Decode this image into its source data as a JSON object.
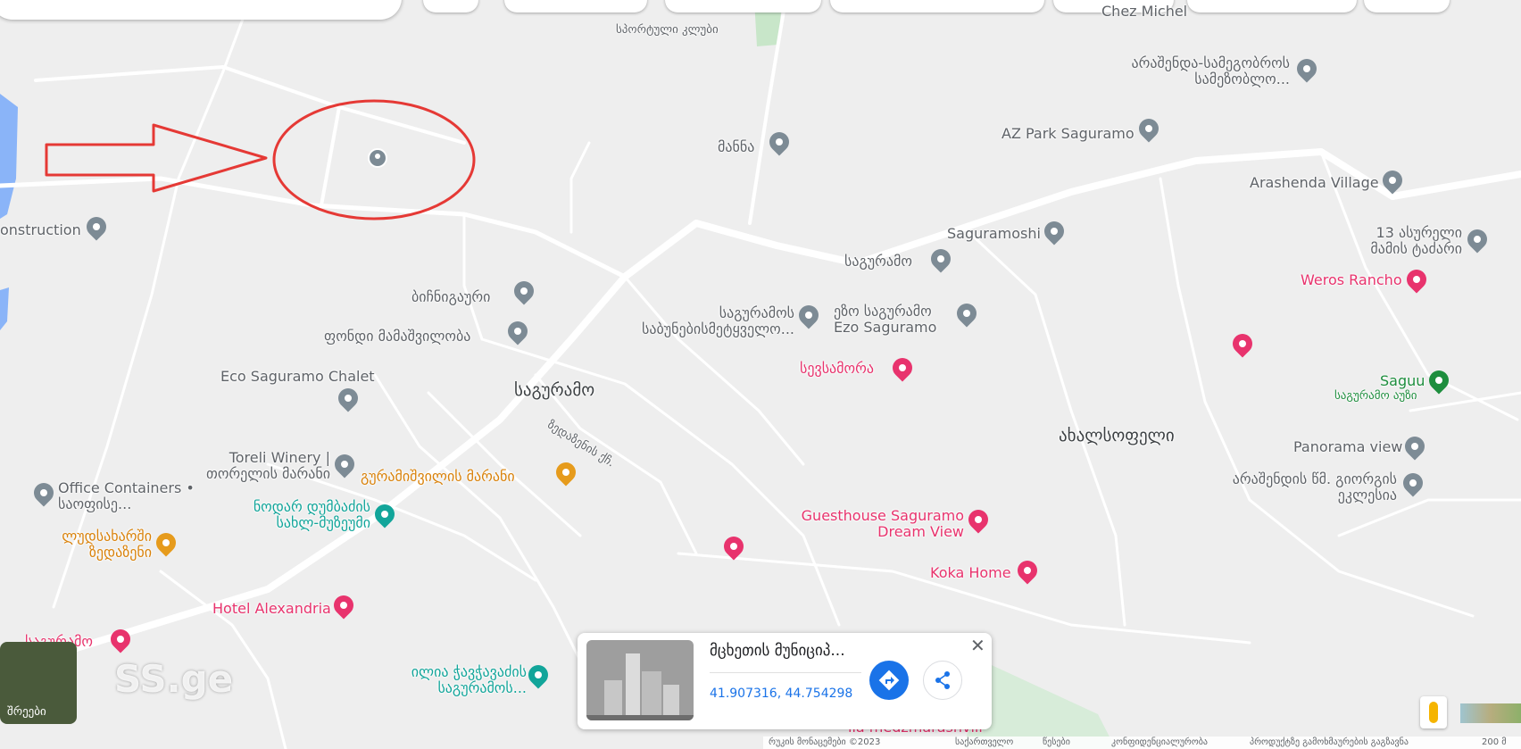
{
  "map": {
    "labels": [
      {
        "name": "construction-label",
        "text": "onstruction"
      },
      {
        "name": "mannna-label",
        "text": "მანნა"
      },
      {
        "name": "arashenda-samegobro-label",
        "text": "არაშენდა-სამეგობროს სამეზობლო..."
      },
      {
        "name": "az-park-label",
        "text": "AZ Park Saguramo"
      },
      {
        "name": "arashenda-village-label",
        "text": "Arashenda Village"
      },
      {
        "name": "saguramoshi-label",
        "text": "Saguramoshi"
      },
      {
        "name": "saguramo-poi-label",
        "text": "საგურამო"
      },
      {
        "name": "13-asureli-label",
        "text": "13 ასურელი მამის ტაძარი"
      },
      {
        "name": "weros-rancho-label",
        "text": "Weros Rancho"
      },
      {
        "name": "bichnigauri-label",
        "text": "ბიჩნიგაური"
      },
      {
        "name": "fondi-mamashvili-label",
        "text": "ფონდი მამაშვილობა"
      },
      {
        "name": "saguramos-school-label",
        "text": "საგურამოს საბუნებისმეტყველო..."
      },
      {
        "name": "ezo-saguramo-label",
        "text": "ეზო საგურამო Ezo Saguramo"
      },
      {
        "name": "sevsamora-label",
        "text": "სევსამორა"
      },
      {
        "name": "saguu-label",
        "text": "Saguu"
      },
      {
        "name": "saguu-sub-label",
        "text": "საგურამო აუზი"
      },
      {
        "name": "eco-chalet-label",
        "text": "Eco Saguramo Chalet"
      },
      {
        "name": "saguramo-village-label",
        "text": "საგურამო"
      },
      {
        "name": "street-label",
        "text": "ზედაზენის ქჩ."
      },
      {
        "name": "akhalsopeli-label",
        "text": "ახალსოფელი"
      },
      {
        "name": "panorama-view-label",
        "text": "Panorama view"
      },
      {
        "name": "toreli-winery-label",
        "text": "Toreli Winery | თორელის მარანი"
      },
      {
        "name": "guramishvili-marani-label",
        "text": "გურამიშვილის მარანი"
      },
      {
        "name": "church-label",
        "text": "არაშენდის წმ. გიორგის ეკლესია"
      },
      {
        "name": "office-containers-label",
        "text": "Office Containers • საოფისე..."
      },
      {
        "name": "nodar-dumbadze-label",
        "text": "ნოდარ დუმბაძის სახლ-მუზეუმი"
      },
      {
        "name": "guesthouse-label",
        "text": "Guesthouse Saguramo Dream View"
      },
      {
        "name": "ludsakharshi-label",
        "text": "ლუდსახარში ზედაზენი"
      },
      {
        "name": "koka-home-label",
        "text": "Koka Home"
      },
      {
        "name": "hotel-alexandria-label",
        "text": "Hotel Alexandria"
      },
      {
        "name": "saguramo-hotel-label",
        "text": "საგურამო"
      },
      {
        "name": "ilia-chavchavadze-label",
        "text": "ილია ჭავჭავაძის საგურამოს..."
      },
      {
        "name": "medzmarashvili-label",
        "text": "ila medzmarashvili"
      },
      {
        "name": "sport-club-label",
        "text": "სპორტული კლუბი"
      },
      {
        "name": "chez-michel-label",
        "text": "Chez Michel"
      }
    ]
  },
  "card": {
    "title": "მცხეთის მუნიციპ...",
    "coords": "41.907316, 44.754298",
    "close": "✕"
  },
  "layers": {
    "label": "შრეები"
  },
  "watermark": "SS.ge",
  "footer": [
    "რუკის მონაცემები ©2023",
    "საქართველო",
    "წესები",
    "კონფიდენციალურობა",
    "პროდუქტზე გამოხმაურების გაგზავნა",
    "200 მ"
  ],
  "colors": {
    "road": "#ffffff",
    "background": "#eeeeee",
    "water": "#8ab4f8",
    "park": "#c8e6c9",
    "annotation": "#e53935"
  }
}
